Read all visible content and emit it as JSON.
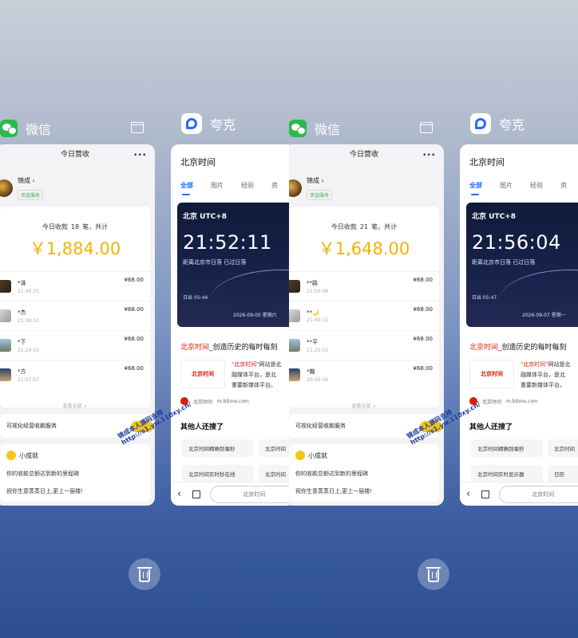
{
  "panes": [
    {
      "wechat": {
        "app_name": "微信",
        "page_title": "今日营收",
        "merchant": "锦成",
        "badge": "资金服务",
        "count_prefix": "今日收款",
        "count": "18",
        "count_suffix": "笔，共计",
        "amount": "￥1,884.00",
        "rows": [
          {
            "name": "*诛",
            "time": "21:45:25",
            "value": "¥68.00"
          },
          {
            "name": "*杰",
            "time": "21:38:10",
            "value": "¥68.00"
          },
          {
            "name": "*下",
            "time": "21:24:02",
            "value": "¥68.00"
          },
          {
            "name": "*方",
            "time": "21:07:57",
            "value": "¥68.00"
          }
        ],
        "view_all": "查看全部 >",
        "service": "可视化经营收款服务",
        "achievement_title": "小成就",
        "achievement_line1": "你的收款总额达到新的里程碑",
        "achievement_line2": "祝你生意蒸蒸日上,更上一层楼!"
      },
      "quark": {
        "app_name": "夸克",
        "page_title": "北京时间",
        "tabs": [
          "全部",
          "图片",
          "经验",
          "资"
        ],
        "utc_label": "北京 UTC+8",
        "time": "21:52:11",
        "sunset": "距离北京市日落 已过日落",
        "sunrise": "日出 05:44",
        "date": "2026-09-05 星期六",
        "result_title_highlight": "北京时间",
        "result_title_rest": "_创造历史的每时每刻",
        "result_logo": "北京时间",
        "result_line1_highlight": "\"北京时间\"",
        "result_line1_rest": "网站是北",
        "result_line2": "融媒体平台，是北",
        "result_line3": "重要新媒体平台。",
        "result_source": "北京时间",
        "result_url": "m.btime.com",
        "also_title": "其他人还搜了",
        "chips": [
          "北京时间精确到毫秒",
          "北京时间",
          "北京时间实时秒在线",
          "北京时间"
        ],
        "address_bar": "北京时间"
      },
      "watermark": "锦成本人源码支持\nhttp://s1.yw.110xy.cn/"
    },
    {
      "wechat": {
        "app_name": "微信",
        "page_title": "今日营收",
        "merchant": "锦成",
        "badge": "资金服务",
        "count_prefix": "今日收款",
        "count": "21",
        "count_suffix": "笔，共计",
        "amount": "￥1,648.00",
        "rows": [
          {
            "name": "**路",
            "time": "21:50:08",
            "value": "¥68.00"
          },
          {
            "name": "**🌙",
            "time": "21:40:11",
            "value": "¥68.00"
          },
          {
            "name": "**平",
            "time": "21:20:53",
            "value": "¥68.00"
          },
          {
            "name": "*翰",
            "time": "20:56:56",
            "value": "¥68.00"
          }
        ],
        "view_all": "查看全部 >",
        "service": "可视化经营收款服务",
        "achievement_title": "小成就",
        "achievement_line1": "你的收款总额达到新的里程碑",
        "achievement_line2": "祝你生意蒸蒸日上,更上一层楼!"
      },
      "quark": {
        "app_name": "夸克",
        "page_title": "北京时间",
        "tabs": [
          "全部",
          "图片",
          "经验",
          "资"
        ],
        "utc_label": "北京 UTC+8",
        "time": "21:56:04",
        "sunset": "距离北京市日落 已过日落",
        "sunrise": "日出 05:47",
        "date": "2026-09-07 星期一",
        "result_title_highlight": "北京时间",
        "result_title_rest": "_创造历史的每时每刻",
        "result_logo": "北京时间",
        "result_line1_highlight": "\"北京时间\"",
        "result_line1_rest": "网站是北",
        "result_line2": "融媒体平台，是北",
        "result_line3": "重要新媒体平台。",
        "result_source": "北京时间",
        "result_url": "m.btime.com",
        "also_title": "其他人还搜了",
        "chips": [
          "北京时间精确到毫秒",
          "北京时间",
          "北京时间实时显示器",
          "日历"
        ],
        "address_bar": "北京时间"
      },
      "watermark": "锦成本人源码支持\nhttp://s1.yw.110xy.cn/"
    }
  ],
  "colors": {
    "accent": "#1f6dff",
    "amount": "#f0b400",
    "wechat": "#2bb94a",
    "btime_red": "#d81e06"
  }
}
